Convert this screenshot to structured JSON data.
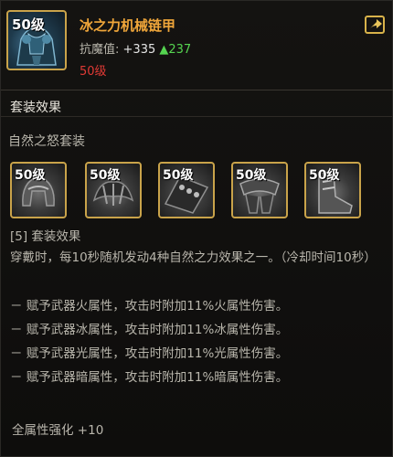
{
  "item": {
    "icon_name": "armor-chest-icon",
    "level_badge": "50级",
    "name": "冰之力机械链甲",
    "stat_label": "抗魔值:",
    "stat_plus": "+335",
    "stat_up": "▲237",
    "required_level": "50级"
  },
  "header": {
    "share_icon": "share-icon"
  },
  "section": {
    "title": "套装效果"
  },
  "set": {
    "name": "自然之怒套装",
    "items": [
      {
        "level": "50级",
        "icon": "helmet-icon"
      },
      {
        "level": "50级",
        "icon": "shoulder-armor-icon"
      },
      {
        "level": "50级",
        "icon": "belt-icon"
      },
      {
        "level": "50级",
        "icon": "leg-armor-icon"
      },
      {
        "level": "50级",
        "icon": "boots-icon"
      }
    ]
  },
  "effect": {
    "title": "[5] 套装效果",
    "description": "穿戴时，每10秒随机发动4种自然之力效果之一。（冷却时间10秒）",
    "lines": [
      "－ 赋予武器火属性，攻击时附加11%火属性伤害。",
      "－ 赋予武器冰属性，攻击时附加11%冰属性伤害。",
      "－ 赋予武器光属性，攻击时附加11%光属性伤害。",
      "－ 赋予武器暗属性，攻击时附加11%暗属性伤害。"
    ],
    "all_attribute": "全属性强化 +10"
  },
  "colors": {
    "item_name": "#f0a63a",
    "required_level": "#e03a35",
    "stat_up": "#55d450",
    "frame_gold": "#c9a34a"
  }
}
